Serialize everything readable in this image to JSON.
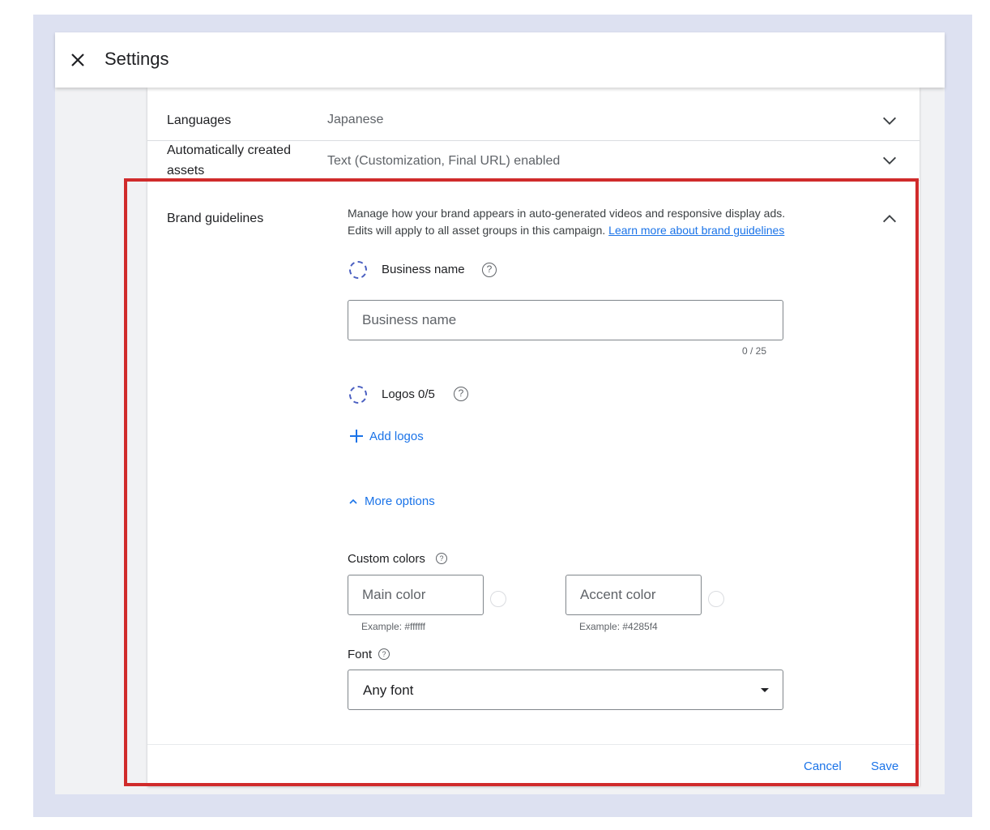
{
  "header": {
    "title": "Settings"
  },
  "rows": [
    {
      "label": "Languages",
      "value": "Japanese"
    },
    {
      "label": "Automatically created assets",
      "value": "Text (Customization, Final URL) enabled"
    }
  ],
  "brand": {
    "label": "Brand guidelines",
    "description_line1": "Manage how your brand appears in auto-generated videos and responsive display ads.",
    "description_line2": "Edits will apply to all asset groups in this campaign.",
    "learn_more": "Learn more about brand guidelines",
    "business_name_label": "Business name",
    "business_name_placeholder": "Business name",
    "business_name_counter": "0 / 25",
    "logos_label": "Logos 0/5",
    "add_logos": "Add logos",
    "more_options": "More options",
    "custom_colors_label": "Custom colors",
    "main_color_placeholder": "Main color",
    "main_color_example": "Example: #ffffff",
    "accent_color_placeholder": "Accent color",
    "accent_color_example": "Example: #4285f4",
    "font_label": "Font",
    "font_value": "Any font"
  },
  "footer": {
    "cancel": "Cancel",
    "save": "Save"
  },
  "colors": {
    "accent": "#1a73e8",
    "highlight": "#d02b2b",
    "background": "#dde1f1"
  },
  "icons": [
    "close-icon",
    "chevron-down-icon",
    "chevron-up-icon",
    "help-icon",
    "plus-icon",
    "dropdown-arrow-icon"
  ]
}
